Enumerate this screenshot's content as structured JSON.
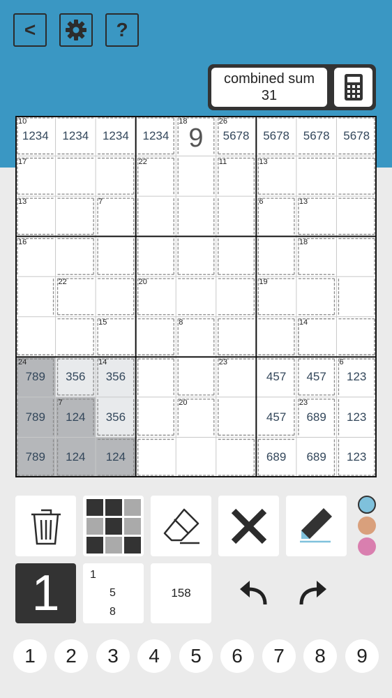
{
  "header": {
    "back_label": "<",
    "help_label": "?",
    "back_icon": "back-icon",
    "settings_icon": "gear-icon",
    "combined_sum_label": "combined sum",
    "combined_sum_value": "31",
    "calculator_icon": "calculator-icon"
  },
  "board": {
    "rows": [
      [
        "1234",
        "1234",
        "1234",
        "1234",
        "9",
        "5678",
        "5678",
        "5678",
        "5678"
      ],
      [
        "",
        "",
        "",
        "",
        "",
        "",
        "",
        "",
        ""
      ],
      [
        "",
        "",
        "",
        "",
        "",
        "",
        "",
        "",
        ""
      ],
      [
        "",
        "",
        "",
        "",
        "",
        "",
        "",
        "",
        ""
      ],
      [
        "",
        "",
        "",
        "",
        "",
        "",
        "",
        "",
        ""
      ],
      [
        "",
        "",
        "",
        "",
        "",
        "",
        "",
        "",
        ""
      ],
      [
        "789",
        "356",
        "356",
        "",
        "",
        "",
        "457",
        "457",
        "123"
      ],
      [
        "789",
        "124",
        "356",
        "",
        "",
        "",
        "457",
        "689",
        "123"
      ],
      [
        "789",
        "124",
        "124",
        "",
        "",
        "",
        "689",
        "689",
        "123"
      ]
    ],
    "big_cells": [
      [
        0,
        4
      ]
    ],
    "highlight_dark": [
      [
        6,
        0
      ],
      [
        7,
        0
      ],
      [
        7,
        1
      ],
      [
        8,
        0
      ],
      [
        8,
        1
      ],
      [
        8,
        2
      ]
    ],
    "highlight_light": [
      [
        6,
        1
      ],
      [
        6,
        2
      ],
      [
        7,
        2
      ]
    ],
    "dark_color": "#b5b7ba",
    "light_color": "#e8eaec",
    "cages": [
      {
        "sum": "10",
        "cells": [
          [
            0,
            0
          ],
          [
            0,
            1
          ],
          [
            0,
            2
          ],
          [
            0,
            3
          ]
        ]
      },
      {
        "sum": "18",
        "cells": [
          [
            0,
            4
          ],
          [
            1,
            4
          ],
          [
            2,
            4
          ],
          [
            3,
            4
          ]
        ]
      },
      {
        "sum": "26",
        "cells": [
          [
            0,
            5
          ],
          [
            0,
            6
          ],
          [
            0,
            7
          ],
          [
            0,
            8
          ]
        ]
      },
      {
        "sum": "17",
        "cells": [
          [
            1,
            0
          ],
          [
            1,
            1
          ],
          [
            1,
            2
          ]
        ]
      },
      {
        "sum": "22",
        "cells": [
          [
            1,
            3
          ],
          [
            2,
            3
          ],
          [
            3,
            3
          ]
        ]
      },
      {
        "sum": "11",
        "cells": [
          [
            1,
            5
          ],
          [
            2,
            5
          ],
          [
            3,
            5
          ]
        ]
      },
      {
        "sum": "13",
        "cells": [
          [
            1,
            6
          ],
          [
            1,
            7
          ],
          [
            1,
            8
          ]
        ]
      },
      {
        "sum": "13",
        "cells": [
          [
            2,
            0
          ],
          [
            2,
            1
          ]
        ]
      },
      {
        "sum": "7",
        "cells": [
          [
            2,
            2
          ],
          [
            3,
            2
          ]
        ]
      },
      {
        "sum": "6",
        "cells": [
          [
            2,
            6
          ],
          [
            3,
            6
          ]
        ]
      },
      {
        "sum": "13",
        "cells": [
          [
            2,
            7
          ],
          [
            2,
            8
          ]
        ]
      },
      {
        "sum": "16",
        "cells": [
          [
            3,
            0
          ],
          [
            3,
            1
          ],
          [
            4,
            0
          ],
          [
            5,
            0
          ],
          [
            5,
            1
          ]
        ]
      },
      {
        "sum": "18",
        "cells": [
          [
            3,
            7
          ],
          [
            3,
            8
          ],
          [
            4,
            8
          ],
          [
            5,
            7
          ],
          [
            5,
            8
          ]
        ]
      },
      {
        "sum": "22",
        "cells": [
          [
            4,
            1
          ],
          [
            4,
            2
          ]
        ]
      },
      {
        "sum": "20",
        "cells": [
          [
            4,
            3
          ],
          [
            4,
            4
          ],
          [
            4,
            5
          ]
        ]
      },
      {
        "sum": "19",
        "cells": [
          [
            4,
            6
          ],
          [
            4,
            7
          ]
        ]
      },
      {
        "sum": "15",
        "cells": [
          [
            5,
            2
          ],
          [
            5,
            3
          ]
        ]
      },
      {
        "sum": "8",
        "cells": [
          [
            5,
            4
          ],
          [
            6,
            4
          ]
        ]
      },
      {
        "sum": "",
        "cells": [
          [
            5,
            5
          ],
          [
            5,
            6
          ]
        ]
      },
      {
        "sum": "14",
        "cells": [
          [
            5,
            7
          ],
          [
            5,
            8
          ]
        ]
      },
      {
        "sum": "24",
        "cells": [
          [
            6,
            0
          ],
          [
            7,
            0
          ],
          [
            8,
            0
          ]
        ]
      },
      {
        "sum": "",
        "cells": [
          [
            6,
            1
          ]
        ]
      },
      {
        "sum": "14",
        "cells": [
          [
            6,
            2
          ],
          [
            7,
            2
          ]
        ]
      },
      {
        "sum": "",
        "cells": [
          [
            6,
            3
          ],
          [
            7,
            3
          ]
        ]
      },
      {
        "sum": "23",
        "cells": [
          [
            6,
            5
          ],
          [
            7,
            5
          ],
          [
            6,
            6
          ],
          [
            7,
            6
          ]
        ]
      },
      {
        "sum": "",
        "cells": [
          [
            6,
            7
          ]
        ]
      },
      {
        "sum": "6",
        "cells": [
          [
            6,
            8
          ],
          [
            7,
            8
          ],
          [
            8,
            8
          ]
        ]
      },
      {
        "sum": "7",
        "cells": [
          [
            7,
            1
          ],
          [
            8,
            1
          ],
          [
            8,
            2
          ]
        ]
      },
      {
        "sum": "20",
        "cells": [
          [
            7,
            4
          ],
          [
            8,
            3
          ],
          [
            8,
            4
          ],
          [
            8,
            5
          ]
        ]
      },
      {
        "sum": "23",
        "cells": [
          [
            7,
            7
          ],
          [
            8,
            6
          ],
          [
            8,
            7
          ]
        ]
      }
    ]
  },
  "tools": {
    "delete_icon": "trash-icon",
    "pattern_icon": "grid-pattern-icon",
    "eraser_icon": "eraser-icon",
    "cross_icon": "cross-icon",
    "pen_icon": "pen-icon"
  },
  "colors": [
    {
      "name": "blue",
      "hex": "#7fc1dc"
    },
    {
      "name": "orange",
      "hex": "#d9a07c"
    },
    {
      "name": "pink",
      "hex": "#d97faf"
    }
  ],
  "modes": {
    "big_digit": "1",
    "corner_lines": [
      "1",
      "5",
      "8"
    ],
    "center_text": "158"
  },
  "actions": {
    "undo_icon": "undo-icon",
    "redo_icon": "redo-icon"
  },
  "numbers": [
    "1",
    "2",
    "3",
    "4",
    "5",
    "6",
    "7",
    "8",
    "9"
  ]
}
